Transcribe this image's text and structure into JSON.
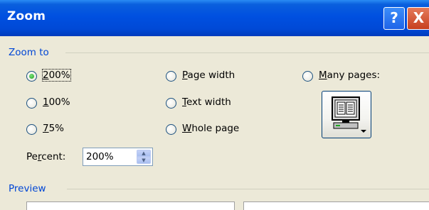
{
  "window": {
    "title": "Zoom",
    "help_glyph": "?",
    "close_glyph": "X"
  },
  "zoom_to": {
    "group_label": "Zoom to",
    "options": [
      {
        "label_pre": "",
        "label_u": "2",
        "label_post": "00%",
        "checked": true
      },
      {
        "label_pre": "",
        "label_u": "1",
        "label_post": "00%",
        "checked": false
      },
      {
        "label_pre": "",
        "label_u": "7",
        "label_post": "5%",
        "checked": false
      },
      {
        "label_pre": "",
        "label_u": "P",
        "label_post": "age width",
        "checked": false
      },
      {
        "label_pre": "",
        "label_u": "T",
        "label_post": "ext width",
        "checked": false
      },
      {
        "label_pre": "",
        "label_u": "W",
        "label_post": "hole page",
        "checked": false
      },
      {
        "label_pre": "",
        "label_u": "M",
        "label_post": "any pages:",
        "checked": false
      }
    ],
    "percent": {
      "label_pre": "Pe",
      "label_u": "r",
      "label_post": "cent:",
      "value": "200%"
    },
    "many_pages_button_icon": "monitor-pages-icon"
  },
  "preview": {
    "group_label": "Preview"
  },
  "colors": {
    "title_bar": "#0050E0",
    "dialog_bg": "#ECE9D8",
    "group_label": "#0046D5"
  }
}
